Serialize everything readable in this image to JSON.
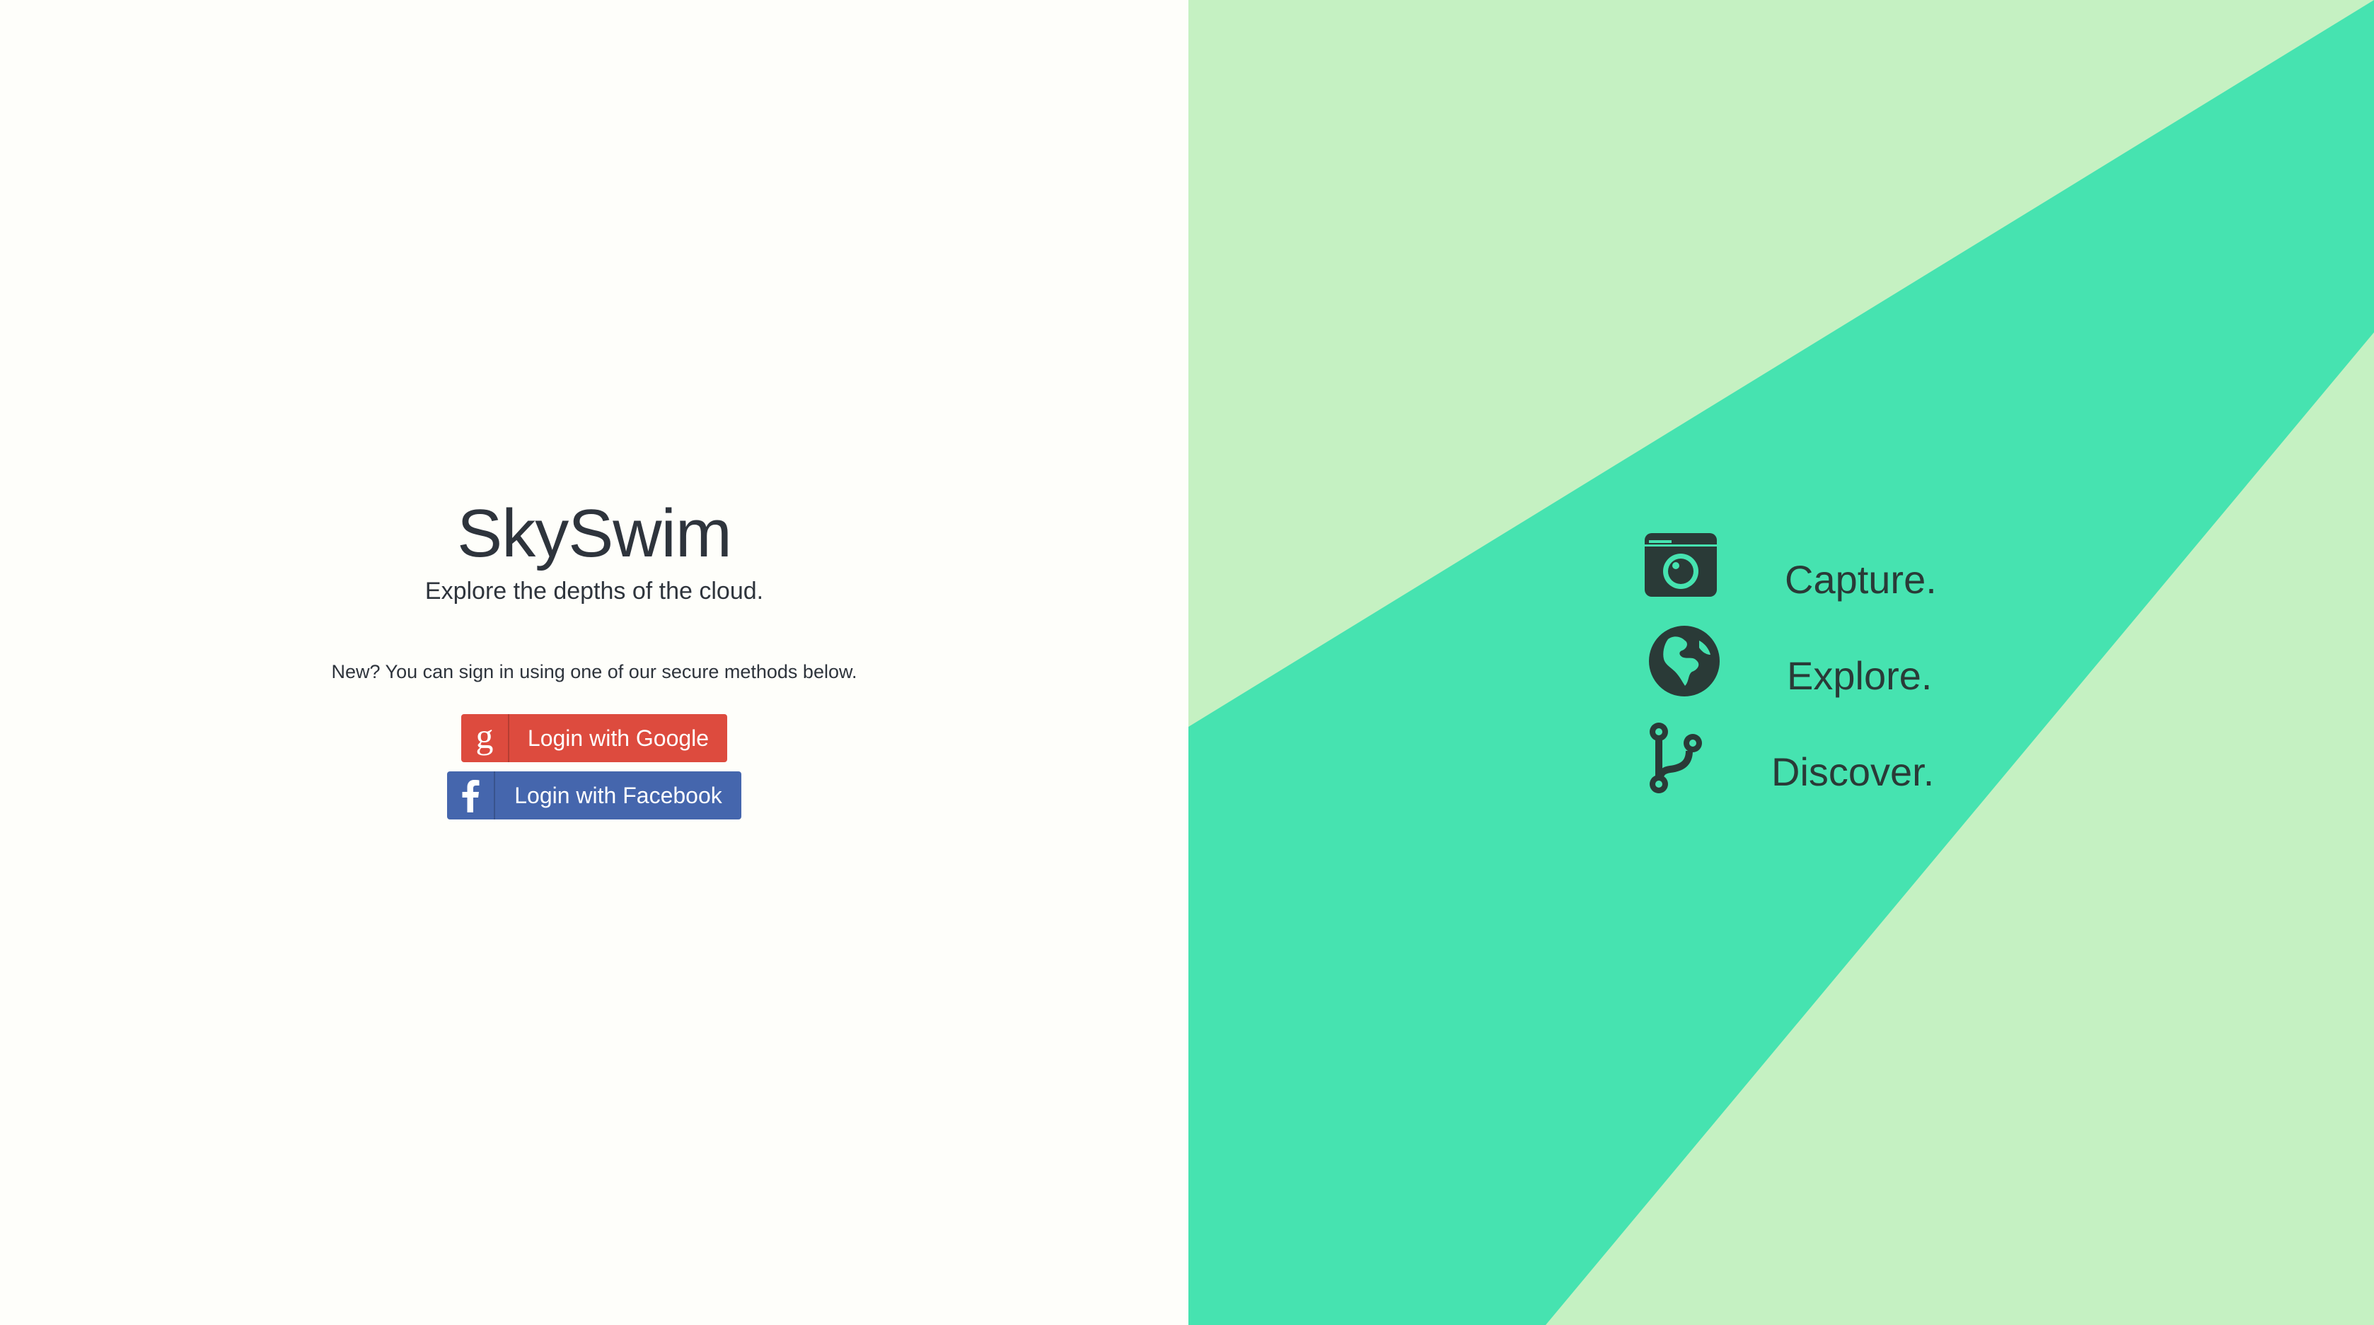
{
  "app": {
    "title": "SkySwim",
    "tagline": "Explore the depths of the cloud."
  },
  "signin": {
    "note": "New? You can sign in using one of our secure methods below.",
    "google_label": "Login with Google",
    "facebook_label": "Login with Facebook",
    "google_icon": "google-g-icon",
    "facebook_icon": "facebook-f-icon"
  },
  "features": [
    {
      "label": "Capture.",
      "icon": "camera-icon"
    },
    {
      "label": "Explore.",
      "icon": "globe-icon"
    },
    {
      "label": "Discover.",
      "icon": "branch-icon"
    }
  ],
  "colors": {
    "left_background": "#fefefa",
    "right_background_light": "#c5f1c2",
    "right_background_band": "#46e3b0",
    "text_dark": "#2e343c",
    "google_red": "#dd4b3e",
    "facebook_blue": "#4566ad"
  }
}
